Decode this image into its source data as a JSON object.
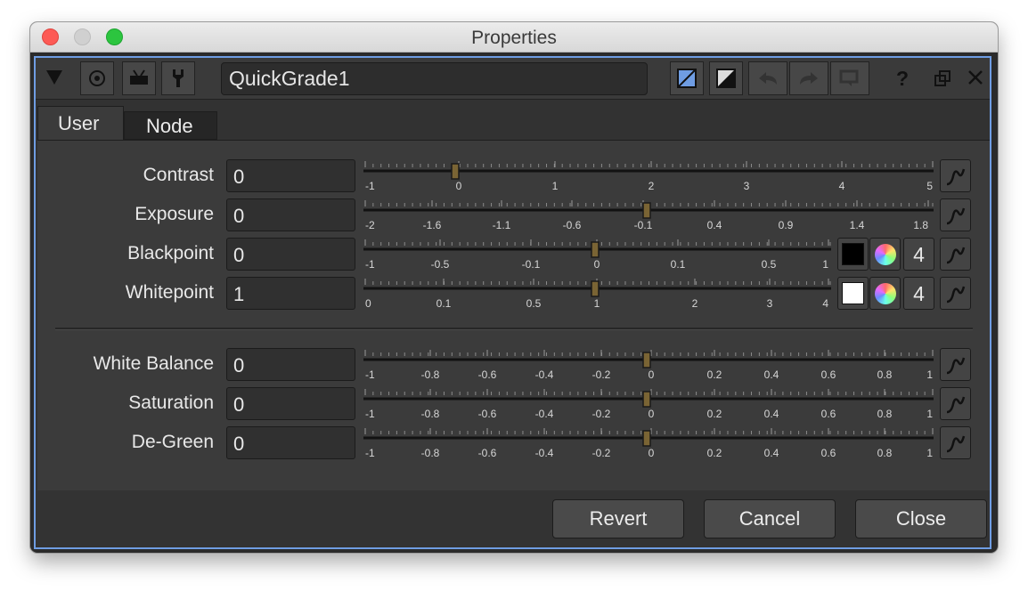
{
  "window": {
    "title": "Properties"
  },
  "toolbar": {
    "node_name": "QuickGrade1",
    "help_label": "?"
  },
  "tabs": [
    {
      "label": "User"
    },
    {
      "label": "Node"
    }
  ],
  "params": [
    {
      "label": "Contrast",
      "value": "0",
      "ticks": [
        "-1",
        "0",
        "1",
        "2",
        "3",
        "4",
        "5"
      ]
    },
    {
      "label": "Exposure",
      "value": "0",
      "ticks": [
        "-2",
        "-1.6",
        "-1.1",
        "-0.6",
        "-0.1",
        "0.4",
        "0.9",
        "1.4",
        "1.8"
      ]
    },
    {
      "label": "Blackpoint",
      "value": "0",
      "ticks": [
        "-1",
        "-0.5",
        "-0.1",
        "0",
        "0.1",
        "0.5",
        "1"
      ],
      "swatch_color": "#000000",
      "channels": "4"
    },
    {
      "label": "Whitepoint",
      "value": "1",
      "ticks": [
        "0",
        "0.1",
        "0.5",
        "1",
        "2",
        "3",
        "4"
      ],
      "swatch_color": "#ffffff",
      "channels": "4"
    },
    {
      "label": "White Balance",
      "value": "0",
      "ticks": [
        "-1",
        "-0.8",
        "-0.6",
        "-0.4",
        "-0.2",
        "0",
        "0.2",
        "0.4",
        "0.6",
        "0.8",
        "1"
      ]
    },
    {
      "label": "Saturation",
      "value": "0",
      "ticks": [
        "-1",
        "-0.8",
        "-0.6",
        "-0.4",
        "-0.2",
        "0",
        "0.2",
        "0.4",
        "0.6",
        "0.8",
        "1"
      ]
    },
    {
      "label": "De-Green",
      "value": "0",
      "ticks": [
        "-1",
        "-0.8",
        "-0.6",
        "-0.4",
        "-0.2",
        "0",
        "0.2",
        "0.4",
        "0.6",
        "0.8",
        "1"
      ]
    }
  ],
  "footer": {
    "revert_label": "Revert",
    "cancel_label": "Cancel",
    "close_label": "Close"
  },
  "colors": {
    "accent_border": "#6f9de3",
    "handle": "#7a6434"
  }
}
